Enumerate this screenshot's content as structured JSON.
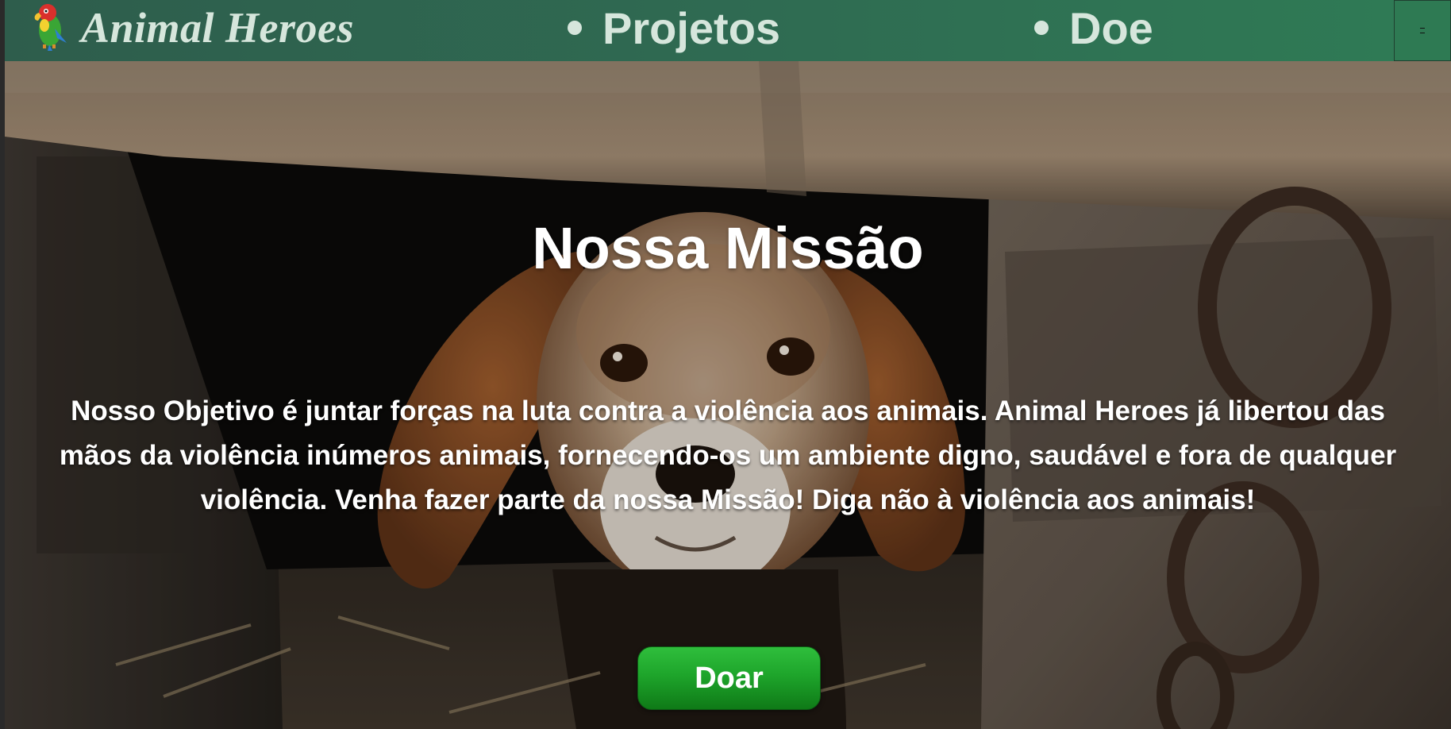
{
  "navbar": {
    "brand": "Animal Heroes",
    "logo_icon": "parrot-icon",
    "links": [
      {
        "label": "Projetos"
      },
      {
        "label": "Doe"
      }
    ],
    "menu_icon": "hamburger-menu-icon",
    "background_color": "#2f6b52",
    "text_color": "#d6e6dc"
  },
  "hero": {
    "background_image": "photo of a sad beagle dog behind concrete blocks with a chain",
    "title": "Nossa Missão",
    "text": "Nosso Objetivo é juntar forças na luta contra a violência aos animais. Animal Heroes já libertou das mãos da violência inúmeros animais, fornecendo-os um ambiente digno, saudável e fora de qualquer violência. Venha fazer parte da nossa Missão! Diga não à violência aos animais!",
    "button_label": "Doar",
    "button_color": "#1ea52b"
  }
}
